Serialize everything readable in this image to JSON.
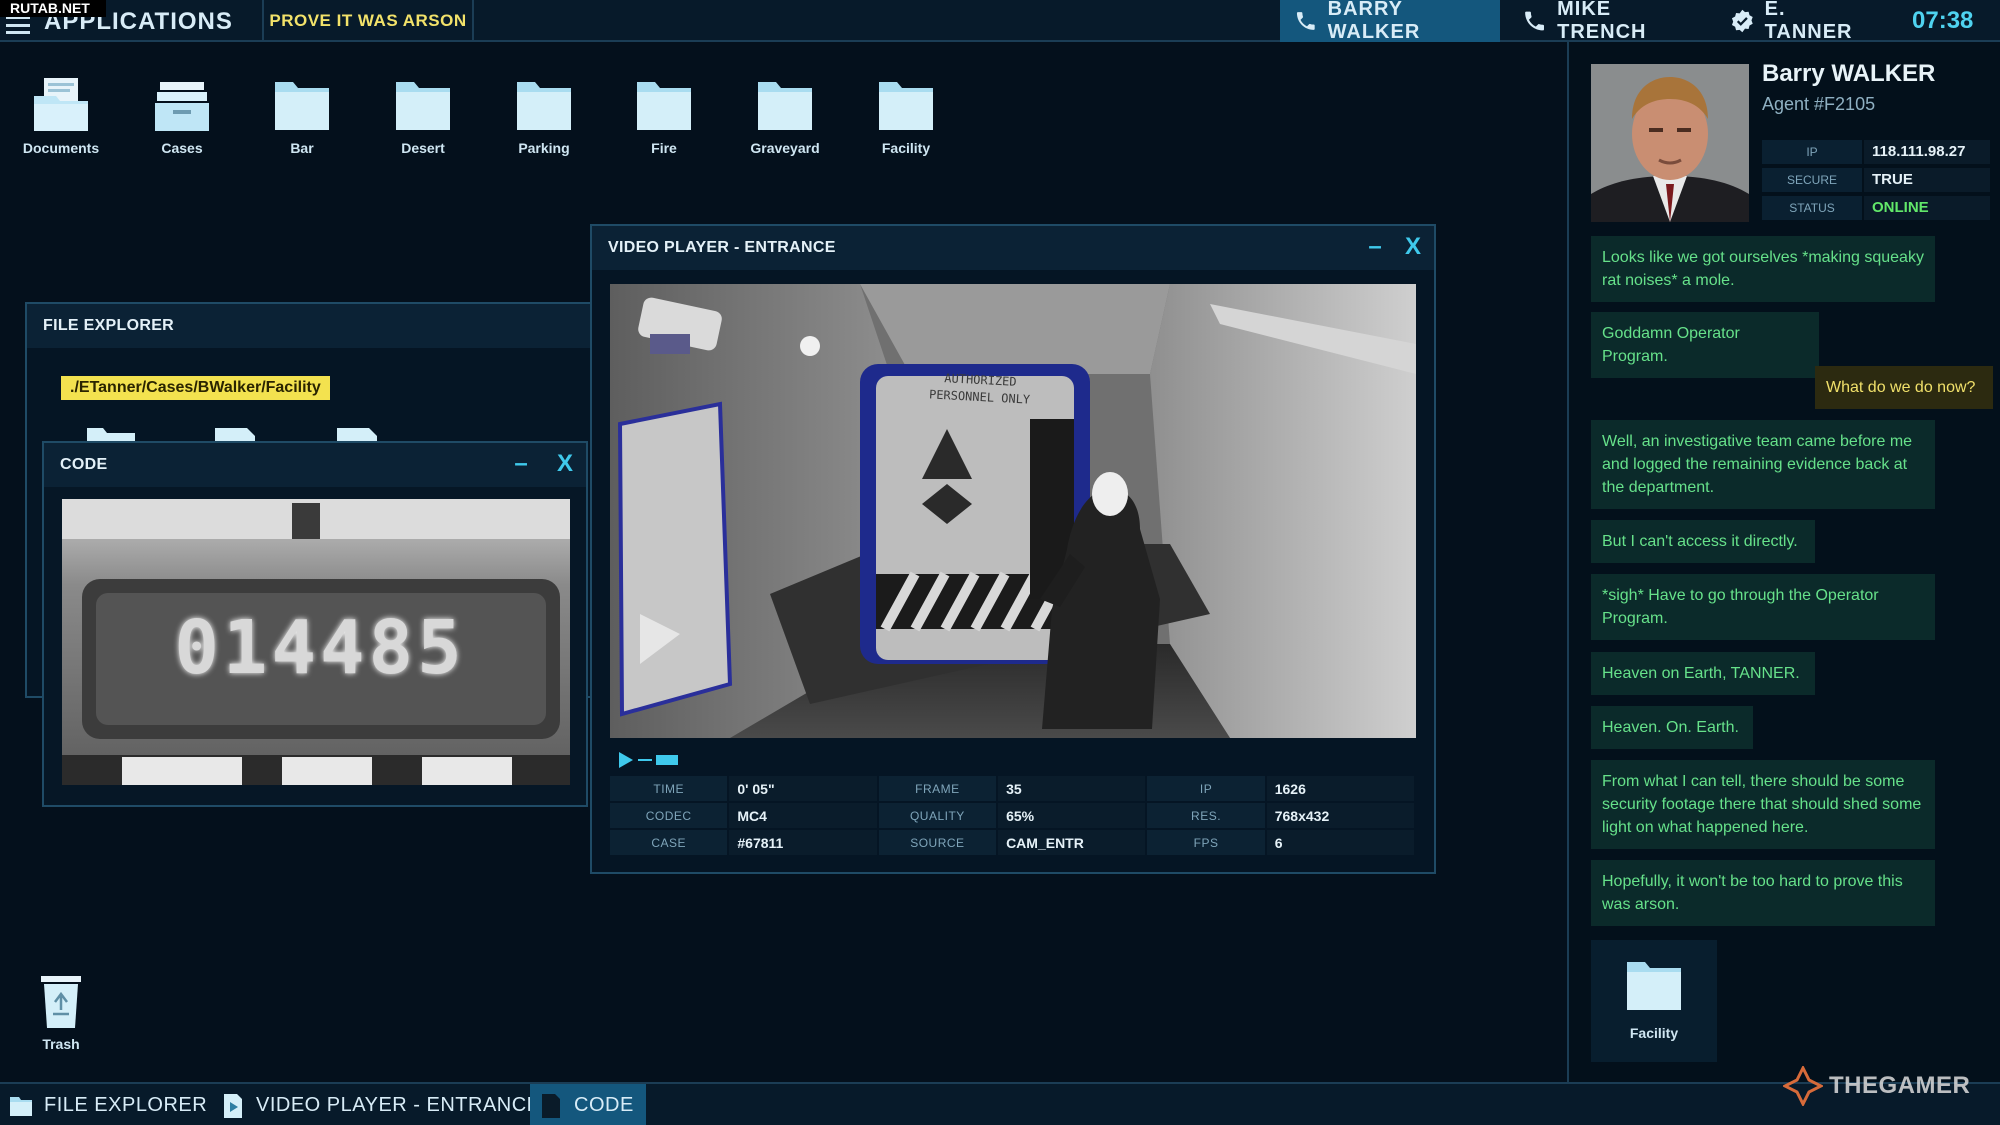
{
  "watermark_top": "RUTAB.NET",
  "topbar": {
    "apps_label": "APPLICATIONS",
    "mission_label": "PROVE IT WAS ARSON",
    "contacts": [
      "BARRY WALKER",
      "MIKE TRENCH",
      "E. TANNER"
    ],
    "clock": "07:38"
  },
  "desktop": {
    "icons": [
      "Documents",
      "Cases",
      "Bar",
      "Desert",
      "Parking",
      "Fire",
      "Graveyard",
      "Facility"
    ],
    "trash_label": "Trash"
  },
  "file_explorer": {
    "title": "FILE EXPLORER",
    "path": "./ETanner/Cases/BWalker/Facility"
  },
  "code_window": {
    "title": "CODE",
    "minimize": "–",
    "close": "X",
    "code_text": "014485"
  },
  "video_player": {
    "title": "VIDEO PLAYER - ENTRANCE",
    "minimize": "–",
    "close": "X",
    "sign_text": [
      "AUTHORIZED",
      "PERSONNEL ONLY"
    ],
    "meta": [
      [
        {
          "k": "TIME",
          "v": "0' 05\""
        },
        {
          "k": "FRAME",
          "v": "35"
        },
        {
          "k": "IP",
          "v": "1626"
        }
      ],
      [
        {
          "k": "CODEC",
          "v": "MC4"
        },
        {
          "k": "QUALITY",
          "v": "65%"
        },
        {
          "k": "RES.",
          "v": "768x432"
        }
      ],
      [
        {
          "k": "CASE",
          "v": "#67811"
        },
        {
          "k": "SOURCE",
          "v": "CAM_ENTR"
        },
        {
          "k": "FPS",
          "v": "6"
        }
      ]
    ]
  },
  "agent": {
    "name": "Barry WALKER",
    "id": "Agent #F2105",
    "info": [
      {
        "k": "IP",
        "v": "118.111.98.27"
      },
      {
        "k": "SECURE",
        "v": "TRUE"
      },
      {
        "k": "STATUS",
        "v": "ONLINE"
      }
    ]
  },
  "chat": {
    "messages": [
      {
        "from": "agent",
        "text": "Looks like we got ourselves *making squeaky rat noises* a mole."
      },
      {
        "from": "agent",
        "text": "Goddamn Operator Program."
      },
      {
        "from": "user",
        "text": "What do we do now?"
      },
      {
        "from": "agent",
        "text": "Well, an investigative team came before me and logged the remaining evidence back at the department."
      },
      {
        "from": "agent",
        "text": "But I can't access it directly."
      },
      {
        "from": "agent",
        "text": "*sigh* Have to go through the Operator Program."
      },
      {
        "from": "agent",
        "text": "Heaven on Earth, TANNER."
      },
      {
        "from": "agent",
        "text": "Heaven. On. Earth."
      },
      {
        "from": "agent",
        "text": "From what I can tell, there should be some security footage there that should shed some light on what happened here."
      },
      {
        "from": "agent",
        "text": "Hopefully, it won't be too hard to prove this was arson."
      }
    ],
    "attachment_label": "Facility"
  },
  "taskbar": {
    "items": [
      "FILE EXPLORER",
      "VIDEO PLAYER - ENTRANCE",
      "CODE"
    ],
    "active": "CODE"
  },
  "brand_watermark": "THEGAMER",
  "colors": {
    "background": "#04101c",
    "accent_cyan": "#3fc9ec",
    "active_tab": "#14577d",
    "path_yellow": "#f3e24f",
    "chat_green": "#66e18a",
    "reply_yellow": "#f0e06a",
    "online_green": "#62e86a"
  }
}
